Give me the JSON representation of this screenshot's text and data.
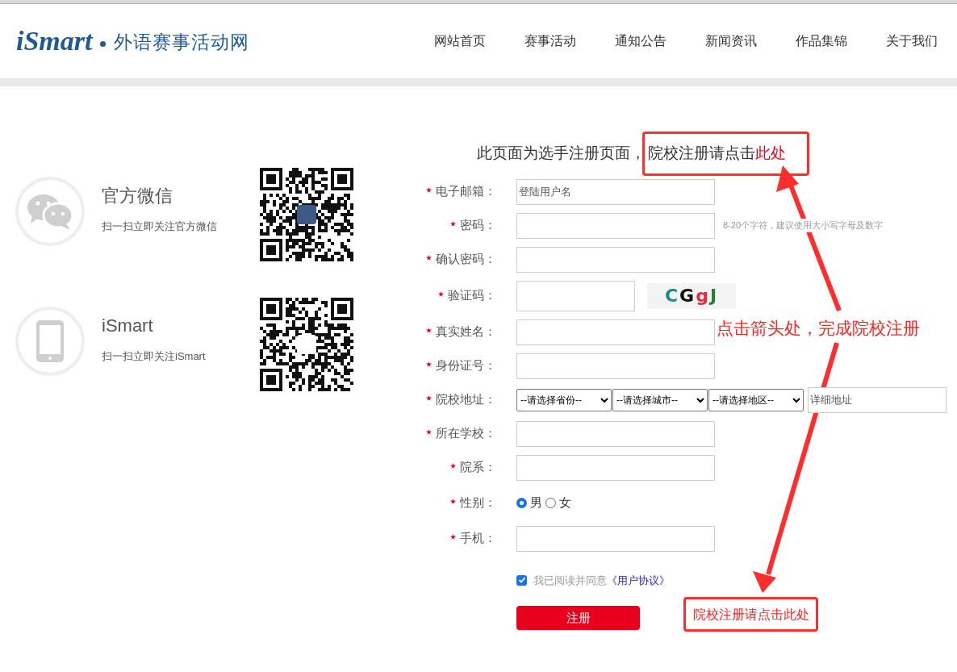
{
  "header": {
    "logo_brand": "iSmart",
    "logo_text": "外语赛事活动网",
    "nav": [
      {
        "label": "网站首页"
      },
      {
        "label": "赛事活动"
      },
      {
        "label": "通知公告"
      },
      {
        "label": "新闻资讯"
      },
      {
        "label": "作品集锦"
      },
      {
        "label": "关于我们"
      }
    ]
  },
  "follow": [
    {
      "kind": "wechat",
      "title": "官方微信",
      "subtitle": "扫一扫立即关注官方微信"
    },
    {
      "kind": "phone",
      "title": "iSmart",
      "subtitle": "扫一扫立即关注iSmart"
    }
  ],
  "form": {
    "heading": "此页面为选手注册页面，",
    "heading_callout": "院校注册请点击",
    "heading_link": "此处",
    "fields": [
      {
        "kind": "text",
        "required": true,
        "label": "电子邮箱：",
        "placeholder": "登陆用户名"
      },
      {
        "kind": "text",
        "required": true,
        "label": "密码：",
        "hint": "8-20个字符，建议使用大小写字母及数字"
      },
      {
        "kind": "text",
        "required": true,
        "label": "确认密码："
      },
      {
        "kind": "captcha",
        "required": true,
        "label": "验证码：",
        "captcha": "CGgJ"
      },
      {
        "kind": "text",
        "required": true,
        "label": "真实姓名："
      },
      {
        "kind": "text",
        "required": true,
        "label": "身份证号："
      },
      {
        "kind": "address",
        "required": true,
        "label": "院校地址：",
        "selects": [
          "--请选择省份--",
          "--请选择城市--",
          "--请选择地区--"
        ],
        "placeholder": "详细地址"
      },
      {
        "kind": "text",
        "required": true,
        "label": "所在学校："
      },
      {
        "kind": "text",
        "required": true,
        "label": "院系："
      },
      {
        "kind": "radio",
        "required": true,
        "label": "性别：",
        "options": [
          {
            "label": "男",
            "selected": true
          },
          {
            "label": "女",
            "selected": false
          }
        ]
      },
      {
        "kind": "text",
        "required": true,
        "label": "手机："
      }
    ],
    "agreement": {
      "checked": true,
      "text": "我已阅读并同意",
      "link": "《用户协议》"
    },
    "submit": "注册"
  },
  "annotations": {
    "note": "点击箭头处，完成院校注册",
    "callout": "院校注册请点击此处"
  }
}
